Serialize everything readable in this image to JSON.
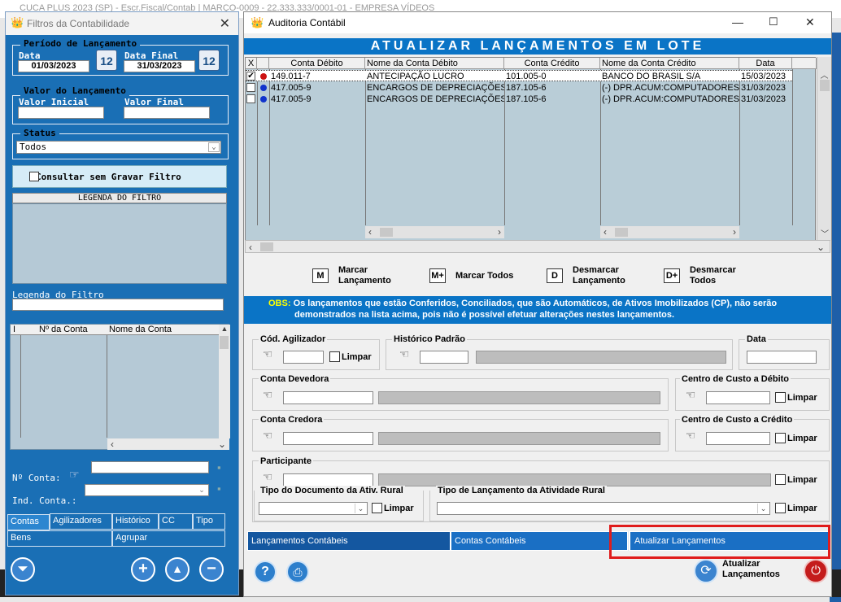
{
  "background": {
    "title": "CUCA PLUS 2023 (SP) - Escr.Fiscal/Contab | MARÇO-0009 - 22.333.333/0001-01 - EMPRESA VÍDEOS"
  },
  "filtros": {
    "title": "Filtros da Contabilidade",
    "periodo_title": "Período de Lançamento",
    "data_label": "Data",
    "data_value": "01/03/2023",
    "data_final_label": "Data Final",
    "data_final_value": "31/03/2023",
    "cal_icon": "12",
    "valor_title": "Valor do Lançamento",
    "valor_inicial_label": "Valor Inicial",
    "valor_final_label": "Valor Final",
    "status_title": "Status",
    "status_value": "Todos",
    "consultar_label": "Consultar sem Gravar Filtro",
    "legenda_header": "LEGENDA DO FILTRO",
    "legenda_label": "Legenda do Filtro",
    "list_cols": [
      "I",
      "Nº da Conta",
      "Nome da Conta"
    ],
    "nconta_label": "Nº Conta:",
    "indconta_label": "Ind. Conta.:",
    "tabs_row1": [
      "Contas",
      "Agilizadores",
      "Histórico",
      "CC",
      "Tipo"
    ],
    "tabs_row2": [
      "Bens",
      "Agrupar"
    ]
  },
  "aud": {
    "title": "Auditoria Contábil",
    "header": "ATUALIZAR LANÇAMENTOS EM LOTE",
    "cols": [
      "X",
      "",
      "Conta Débito",
      "Nome da Conta Débito",
      "Conta Crédito",
      "Nome da Conta Crédito",
      "Data"
    ],
    "rows": [
      {
        "checked": true,
        "dot": "#cc1111",
        "cd": "149.011-7",
        "ncd": "ANTECIPAÇÃO LUCRO",
        "cc": "101.005-0",
        "ncc": "BANCO DO BRASIL S/A",
        "data": "15/03/2023"
      },
      {
        "checked": false,
        "dot": "#1133cc",
        "cd": "417.005-9",
        "ncd": "ENCARGOS DE DEPRECIAÇÕES....",
        "cc": "187.105-6",
        "ncc": "(-) DPR.ACUM:COMPUTADORES E",
        "data": "31/03/2023"
      },
      {
        "checked": false,
        "dot": "#1133cc",
        "cd": "417.005-9",
        "ncd": "ENCARGOS DE DEPRECIAÇÕES....",
        "cc": "187.105-6",
        "ncc": "(-) DPR.ACUM:COMPUTADORES E",
        "data": "31/03/2023"
      }
    ],
    "marcar_icon": "M",
    "marcar_label": [
      "Marcar",
      "Lançamento"
    ],
    "marcar_todos_icon": "M+",
    "marcar_todos_label": "Marcar Todos",
    "desmarcar_icon": "D",
    "desmarcar_label": [
      "Desmarcar",
      "Lançamento"
    ],
    "desmarcar_todos_icon": "D+",
    "desmarcar_todos_label": [
      "Desmarcar",
      "Todos"
    ],
    "obs_prefix": "OBS:",
    "obs_line1": "Os lançamentos que estão Conferidos, Conciliados, que são Automáticos, de Ativos Imobilizados (CP),  não serão",
    "obs_line2": "demonstrados na lista acima, pois não é possível efetuar alterações nestes lançamentos.",
    "cod_agilizador": "Cód. Agilizador",
    "historico_padrao": "Histórico Padrão",
    "data": "Data",
    "limpar": "Limpar",
    "conta_devedora": "Conta Devedora",
    "cc_debito": "Centro de Custo a Débito",
    "conta_credora": "Conta Credora",
    "cc_credito": "Centro de Custo a Crédito",
    "participante": "Participante",
    "tipo_doc": "Tipo do Documento da Ativ. Rural",
    "tipo_lanc": "Tipo de Lançamento da Atividade Rural",
    "bottom_tabs": [
      "Lançamentos Contábeis",
      "Contas Contábeis",
      "Atualizar Lançamentos"
    ],
    "atualizar_label": [
      "Atualizar",
      "Lançamentos"
    ],
    "help_icon": "?"
  },
  "colors": {
    "blue": "#1a6fb5",
    "header_blue": "#0a74c6",
    "obs_yellow": "#ffff00",
    "highlight": "#e01c1c"
  }
}
